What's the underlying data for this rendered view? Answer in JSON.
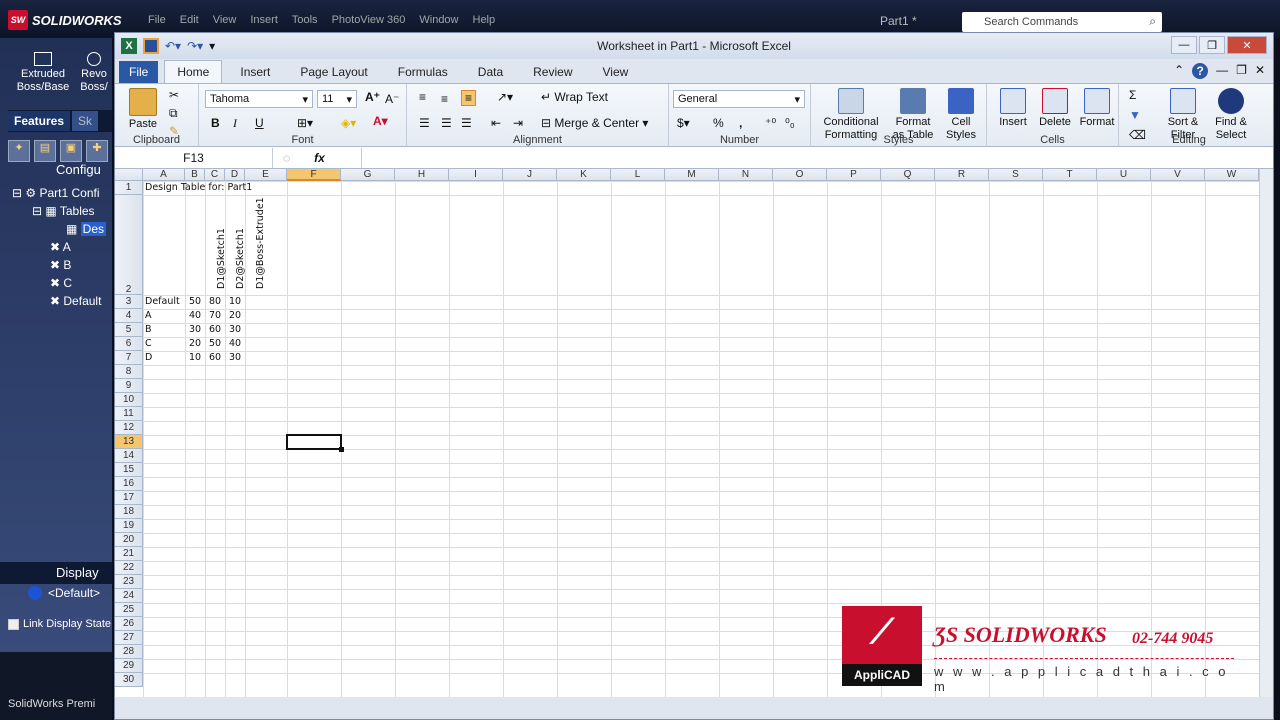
{
  "solidworks": {
    "logo": "SOLIDWORKS",
    "menu": [
      "File",
      "Edit",
      "View",
      "Insert",
      "Tools",
      "PhotoView 360",
      "Window",
      "Help"
    ],
    "doc_title": "Part1 *",
    "search_placeholder": "Search Commands",
    "cmd_extruded": "Extruded Boss/Base",
    "cmd_revolved": "Revo Boss/",
    "tab_features": "Features",
    "tab_sketch": "Sk",
    "config_header": "Configu",
    "tree": {
      "root": "Part1 Confi",
      "tables": "Tables",
      "design_table": "Des",
      "configs": [
        "A",
        "B",
        "C",
        "Default"
      ]
    },
    "display_header": "Display",
    "default_item": "<Default>",
    "link_display": "Link Display State",
    "status": "SolidWorks Premi"
  },
  "excel": {
    "title": "Worksheet in Part1  -  Microsoft Excel",
    "tabs": [
      "File",
      "Home",
      "Insert",
      "Page Layout",
      "Formulas",
      "Data",
      "Review",
      "View"
    ],
    "active_tab": "Home",
    "ribbon": {
      "paste": "Paste",
      "clipboard": "Clipboard",
      "font_name": "Tahoma",
      "font_size": "11",
      "font_group": "Font",
      "bold": "B",
      "italic": "I",
      "underline": "U",
      "wrap_text": "Wrap Text",
      "merge_center": "Merge & Center",
      "alignment": "Alignment",
      "number_format": "General",
      "number": "Number",
      "percent": "%",
      "comma": ",",
      "conditional_formatting": "Conditional Formatting",
      "format_as_table": "Format as Table",
      "cell_styles": "Cell Styles",
      "styles": "Styles",
      "insert": "Insert",
      "delete": "Delete",
      "format": "Format",
      "cells": "Cells",
      "sort_filter": "Sort & Filter",
      "find_select": "Find & Select",
      "editing": "Editing",
      "sum": "Σ"
    },
    "name_box": "F13",
    "fx": "fx",
    "columns": [
      "A",
      "B",
      "C",
      "D",
      "E",
      "F",
      "G",
      "H",
      "I",
      "J",
      "K",
      "L",
      "M",
      "N",
      "O",
      "P",
      "Q",
      "R",
      "S",
      "T",
      "U",
      "V",
      "W"
    ],
    "selected_col": "F",
    "rows": [
      "1",
      "2",
      "3",
      "4",
      "5",
      "6",
      "7",
      "8",
      "9",
      "10",
      "11",
      "12",
      "13",
      "14",
      "15",
      "16",
      "17",
      "18",
      "19",
      "20",
      "21",
      "22",
      "23",
      "24",
      "25",
      "26",
      "27",
      "28",
      "29",
      "30"
    ],
    "selected_row": "13",
    "sheet": {
      "title": "Design Table for: Part1",
      "headers": [
        "D1@Sketch1",
        "D2@Sketch1",
        "D1@Boss-Extrude1"
      ],
      "data": [
        {
          "name": "Default",
          "v": [
            "50",
            "80",
            "10"
          ]
        },
        {
          "name": "A",
          "v": [
            "40",
            "70",
            "20"
          ]
        },
        {
          "name": "B",
          "v": [
            "30",
            "60",
            "30"
          ]
        },
        {
          "name": "C",
          "v": [
            "20",
            "50",
            "40"
          ]
        },
        {
          "name": "D",
          "v": [
            "10",
            "60",
            "30"
          ]
        }
      ]
    }
  },
  "watermark": {
    "appli": "AppliCAD",
    "brand": "SOLIDWORKS",
    "phone": "02-744 9045",
    "url": "w w w . a p p l i c a d t h a i . c o m"
  },
  "colors": {
    "excel_green": "#1e7145",
    "file_tab": "#2b58a5",
    "sw_red": "#c8102e",
    "selection": "#f5c670"
  }
}
